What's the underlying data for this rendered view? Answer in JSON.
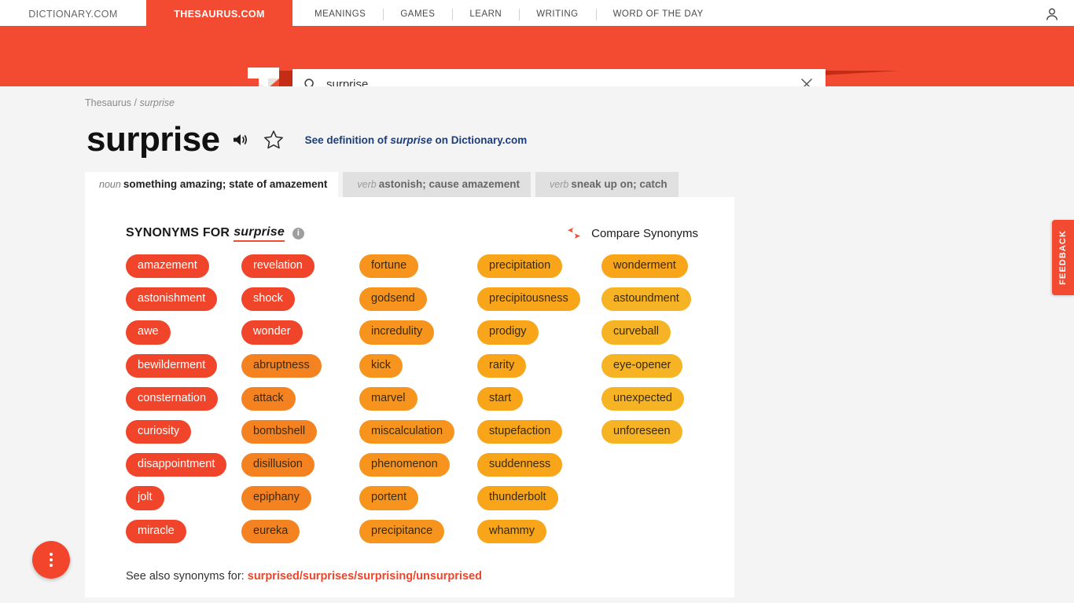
{
  "topnav": {
    "sites": [
      {
        "label": "DICTIONARY.COM",
        "active": false
      },
      {
        "label": "THESAURUS.COM",
        "active": true
      }
    ],
    "links": [
      "MEANINGS",
      "GAMES",
      "LEARN",
      "WRITING",
      "WORD OF THE DAY"
    ],
    "user_icon": "user-account-icon"
  },
  "search": {
    "logo": "thesaurus-t-logo",
    "icon": "search-icon",
    "value": "surprise",
    "placeholder": "",
    "clear_icon": "close-x-icon"
  },
  "breadcrumb": {
    "root": "Thesaurus",
    "separator": "/",
    "current": "surprise"
  },
  "header": {
    "headword": "surprise",
    "speaker_icon": "audio-speaker-icon",
    "star_icon": "star-favorite-icon",
    "see_definition_prefix": "See definition of",
    "see_definition_word": "surprise",
    "see_definition_suffix": "on Dictionary.com"
  },
  "tabs": [
    {
      "pos": "noun",
      "sense": "something amazing; state of amazement",
      "active": true
    },
    {
      "pos": "verb",
      "sense": "astonish; cause amazement",
      "active": false
    },
    {
      "pos": "verb",
      "sense": "sneak up on; catch",
      "active": false
    }
  ],
  "card": {
    "synonyms_label": "SYNONYMS FOR",
    "synonyms_word": "surprise",
    "info_icon": "info-circle-icon",
    "info_glyph": "i",
    "compare_icon": "compare-arrows-icon",
    "compare_label": "Compare Synonyms"
  },
  "synonym_columns": [
    {
      "items": [
        {
          "word": "amazement",
          "level": 1
        },
        {
          "word": "astonishment",
          "level": 1
        },
        {
          "word": "awe",
          "level": 1
        },
        {
          "word": "bewilderment",
          "level": 1
        },
        {
          "word": "consternation",
          "level": 1
        },
        {
          "word": "curiosity",
          "level": 1
        },
        {
          "word": "disappointment",
          "level": 1
        },
        {
          "word": "jolt",
          "level": 1
        },
        {
          "word": "miracle",
          "level": 1
        }
      ]
    },
    {
      "items": [
        {
          "word": "revelation",
          "level": 1
        },
        {
          "word": "shock",
          "level": 1
        },
        {
          "word": "wonder",
          "level": 1
        },
        {
          "word": "abruptness",
          "level": 2
        },
        {
          "word": "attack",
          "level": 2
        },
        {
          "word": "bombshell",
          "level": 2
        },
        {
          "word": "disillusion",
          "level": 2
        },
        {
          "word": "epiphany",
          "level": 2
        },
        {
          "word": "eureka",
          "level": 2
        }
      ]
    },
    {
      "items": [
        {
          "word": "fortune",
          "level": 3
        },
        {
          "word": "godsend",
          "level": 3
        },
        {
          "word": "incredulity",
          "level": 3
        },
        {
          "word": "kick",
          "level": 3
        },
        {
          "word": "marvel",
          "level": 3
        },
        {
          "word": "miscalculation",
          "level": 3
        },
        {
          "word": "phenomenon",
          "level": 3
        },
        {
          "word": "portent",
          "level": 3
        },
        {
          "word": "precipitance",
          "level": 3
        }
      ]
    },
    {
      "items": [
        {
          "word": "precipitation",
          "level": 4
        },
        {
          "word": "precipitousness",
          "level": 4
        },
        {
          "word": "prodigy",
          "level": 4
        },
        {
          "word": "rarity",
          "level": 4
        },
        {
          "word": "start",
          "level": 4
        },
        {
          "word": "stupefaction",
          "level": 4
        },
        {
          "word": "suddenness",
          "level": 4
        },
        {
          "word": "thunderbolt",
          "level": 4
        },
        {
          "word": "whammy",
          "level": 4
        }
      ]
    },
    {
      "items": [
        {
          "word": "wonderment",
          "level": 4
        },
        {
          "word": "astoundment",
          "level": 5
        },
        {
          "word": "curveball",
          "level": 5
        },
        {
          "word": "eye-opener",
          "level": 5
        },
        {
          "word": "unexpected",
          "level": 5
        },
        {
          "word": "unforeseen",
          "level": 5
        }
      ]
    }
  ],
  "see_also": {
    "prefix": "See also synonyms for:",
    "words": [
      "surprised",
      "surprises",
      "surprising",
      "unsurprised"
    ],
    "separator": "/"
  },
  "feedback": {
    "label": "FEEDBACK"
  },
  "fab": {
    "name": "more-options-fab",
    "icon": "vertical-dots-icon"
  },
  "colors": {
    "brand_red": "#f24b32",
    "chip_level_1": "#f0452a",
    "chip_level_2": "#f58220",
    "chip_level_3": "#f7941d",
    "chip_level_4": "#f9a51a",
    "chip_level_5": "#f6b323",
    "link_blue": "#1c3d77"
  }
}
